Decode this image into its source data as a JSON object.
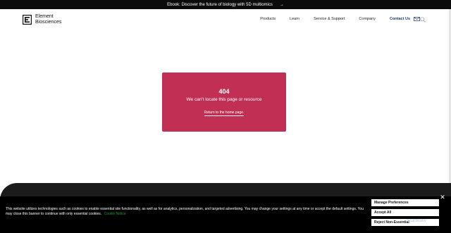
{
  "announcement": {
    "text": "Ebook: Discover the future of biology with 5D multiomics",
    "arrow": "→"
  },
  "header": {
    "logo": {
      "line1": "Element",
      "line2": "Biosciences"
    },
    "nav": [
      {
        "label": "Products"
      },
      {
        "label": "Learn"
      },
      {
        "label": "Service & Support"
      },
      {
        "label": "Company"
      }
    ],
    "contact_label": "Contact Us",
    "icons": {
      "mail": "mail-icon",
      "search": "search-icon"
    }
  },
  "error_card": {
    "code": "404",
    "message": "We can't locate this page or resource",
    "return_link": "Return to the home page.",
    "color": "#c22f54"
  },
  "cookie_banner": {
    "text": "This website utilizes technologies such as cookies to enable essential site functionality, as well as for analytics, personalization, and targeted advertising. You may change your settings at any time or accept the default settings. You may close this banner to continue with only essential cookies.",
    "notice_link": "Cookie Notice",
    "buttons": {
      "manage": "Manage Preferences",
      "accept": "Accept All",
      "reject": "Reject Non-Essential"
    },
    "close": "✕"
  },
  "watermark": "ScanMalw"
}
